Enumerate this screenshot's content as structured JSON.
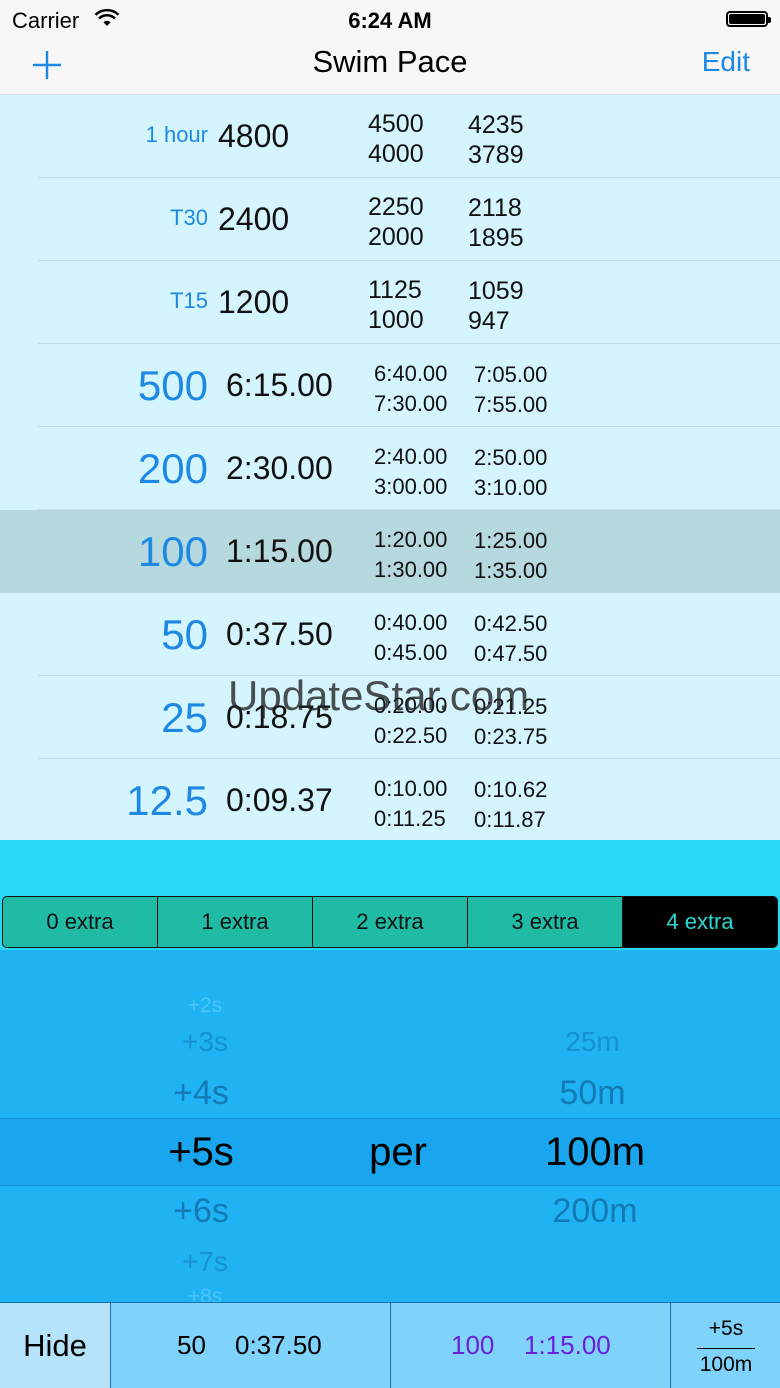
{
  "status_bar": {
    "carrier": "Carrier",
    "time": "6:24 AM"
  },
  "nav": {
    "title": "Swim Pace",
    "edit_label": "Edit",
    "add_icon": "plus-icon"
  },
  "rows": [
    {
      "dist": "1 hour",
      "pace": "4800",
      "c1a": "4500",
      "c1b": "4000",
      "c2a": "4235",
      "c2b": "3789"
    },
    {
      "dist": "T30",
      "pace": "2400",
      "c1a": "2250",
      "c1b": "2000",
      "c2a": "2118",
      "c2b": "1895"
    },
    {
      "dist": "T15",
      "pace": "1200",
      "c1a": "1125",
      "c1b": "1000",
      "c2a": "1059",
      "c2b": "947"
    },
    {
      "dist": "500",
      "pace": "6:15.00",
      "c1a": "6:40.00",
      "c1b": "7:30.00",
      "c2a": "7:05.00",
      "c2b": "7:55.00"
    },
    {
      "dist": "200",
      "pace": "2:30.00",
      "c1a": "2:40.00",
      "c1b": "3:00.00",
      "c2a": "2:50.00",
      "c2b": "3:10.00"
    },
    {
      "dist": "100",
      "pace": "1:15.00",
      "c1a": "1:20.00",
      "c1b": "1:30.00",
      "c2a": "1:25.00",
      "c2b": "1:35.00"
    },
    {
      "dist": "50",
      "pace": "0:37.50",
      "c1a": "0:40.00",
      "c1b": "0:45.00",
      "c2a": "0:42.50",
      "c2b": "0:47.50"
    },
    {
      "dist": "25",
      "pace": "0:18.75",
      "c1a": "0:20.00",
      "c1b": "0:22.50",
      "c2a": "0:21.25",
      "c2b": "0:23.75"
    },
    {
      "dist": "12.5",
      "pace": "0:09.37",
      "c1a": "0:10.00",
      "c1b": "0:11.25",
      "c2a": "0:10.62",
      "c2b": "0:11.87"
    }
  ],
  "selected_row_index": 5,
  "segments": [
    "0 extra",
    "1 extra",
    "2 extra",
    "3 extra",
    "4 extra"
  ],
  "selected_segment": "4 extra",
  "picker": {
    "seconds": [
      "+2s",
      "+3s",
      "+4s",
      "+5s",
      "+6s",
      "+7s",
      "+8s"
    ],
    "selected_seconds": "+5s",
    "per_label": "per",
    "distances": [
      "25m",
      "50m",
      "100m",
      "200m"
    ],
    "selected_distance": "100m"
  },
  "bottom": {
    "hide_label": "Hide",
    "left_dist": "50",
    "left_time": "0:37.50",
    "right_dist": "100",
    "right_time": "1:15.00",
    "frac_top": "+5s",
    "frac_bottom": "100m"
  },
  "watermark": "UpdateStar.com",
  "colors": {
    "accent": "#1e88e5",
    "purple": "#6a1fd8",
    "segment_active_text": "#2ad8d0"
  }
}
